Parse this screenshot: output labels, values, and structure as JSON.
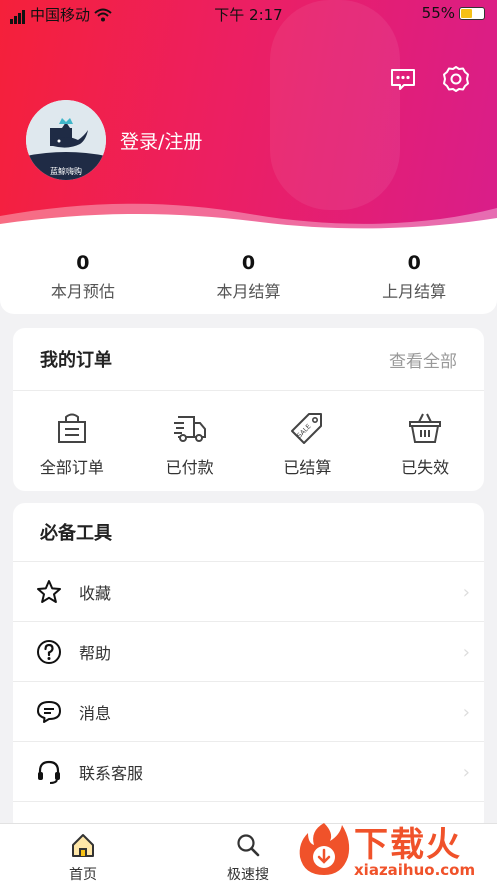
{
  "status_bar": {
    "carrier": "中国移动",
    "time": "下午 2:17",
    "battery": "55%"
  },
  "profile": {
    "login_label": "登录/注册",
    "avatar_text": "蓝鲸嗨购"
  },
  "stats": [
    {
      "value": "0",
      "label": "本月预估"
    },
    {
      "value": "0",
      "label": "本月结算"
    },
    {
      "value": "0",
      "label": "上月结算"
    }
  ],
  "orders": {
    "title": "我的订单",
    "view_all": "查看全部",
    "items": [
      {
        "label": "全部订单",
        "icon": "shopping-bag-icon"
      },
      {
        "label": "已付款",
        "icon": "delivery-truck-icon"
      },
      {
        "label": "已结算",
        "icon": "sale-tag-icon"
      },
      {
        "label": "已失效",
        "icon": "basket-icon"
      }
    ]
  },
  "tools": {
    "title": "必备工具",
    "items": [
      {
        "label": "收藏",
        "icon": "star-icon"
      },
      {
        "label": "帮助",
        "icon": "help-icon"
      },
      {
        "label": "消息",
        "icon": "message-icon"
      },
      {
        "label": "联系客服",
        "icon": "headset-icon"
      }
    ]
  },
  "tabbar": [
    {
      "label": "首页",
      "icon": "home-icon"
    },
    {
      "label": "极速搜",
      "icon": "search-icon"
    }
  ],
  "watermark": {
    "title": "下载火",
    "url": "xiazaihuo.com"
  },
  "colors": {
    "header_start": "#f5203a",
    "header_end": "#d91e8a",
    "watermark": "#f0522a"
  }
}
